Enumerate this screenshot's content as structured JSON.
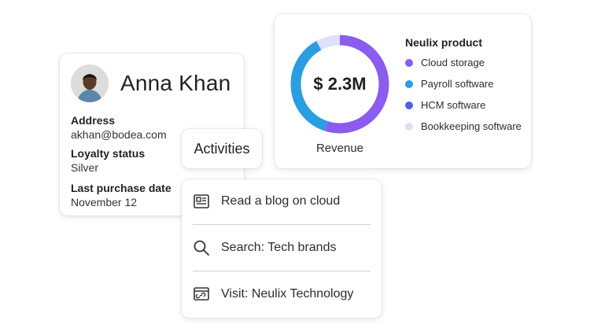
{
  "profile": {
    "name": "Anna Khan",
    "fields": [
      {
        "label": "Address",
        "value": "akhan@bodea.com"
      },
      {
        "label": "Loyalty status",
        "value": "Silver"
      },
      {
        "label": "Last purchase date",
        "value": "November 12"
      }
    ]
  },
  "revenue": {
    "center_value": "$ 2.3M",
    "caption": "Revenue",
    "legend_title": "Neulix product",
    "legend": [
      {
        "label": "Cloud storage",
        "color": "#8a5cf0"
      },
      {
        "label": "Payroll software",
        "color": "#2a9ee0"
      },
      {
        "label": "HCM software",
        "color": "#4f5df0"
      },
      {
        "label": "Bookkeeping software",
        "color": "#dde0f7"
      }
    ]
  },
  "chart_data": {
    "type": "pie",
    "labels": [
      "Cloud storage",
      "Payroll software",
      "Bookkeeping software"
    ],
    "values": [
      55,
      37,
      8
    ],
    "colors": [
      "#8a5cf0",
      "#2a9ee0",
      "#dde0f7"
    ],
    "title": ""
  },
  "activities": {
    "title": "Activities",
    "items": [
      {
        "label": "Read a blog on cloud",
        "icon": "article-icon"
      },
      {
        "label": "Search: Tech brands",
        "icon": "search-icon"
      },
      {
        "label": "Visit: Neulix Technology",
        "icon": "web-link-icon"
      }
    ]
  }
}
